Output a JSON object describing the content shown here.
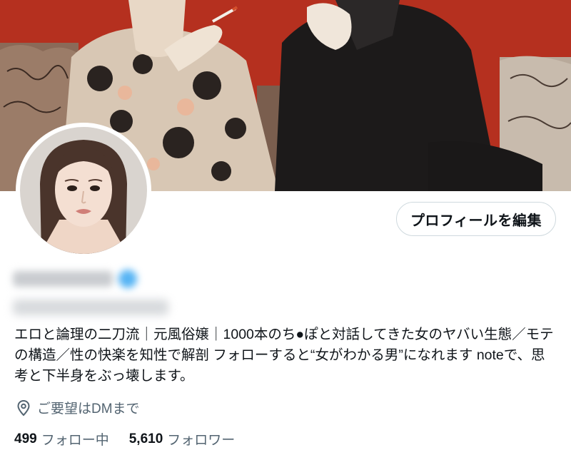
{
  "profile": {
    "edit_button": "プロフィールを編集",
    "bio": "エロと論理の二刀流｜元風俗嬢｜1000本のち●ぽと対話してきた女のヤバい生態／モテの構造／性の快楽を知性で解剖 フォローすると“女がわかる男”になれます noteで、思考と下半身をぶっ壊します。",
    "location": "ご要望はDMまで",
    "following_count": "499",
    "following_label": "フォロー中",
    "followers_count": "5,610",
    "followers_label": "フォロワー"
  },
  "icons": {
    "location": "location-pin-icon",
    "verified": "verified-badge-icon"
  },
  "colors": {
    "banner_red": "#b5301f",
    "secondary_text": "#536471",
    "button_border": "#cfd9de",
    "verified_blue": "#1d9bf0"
  }
}
